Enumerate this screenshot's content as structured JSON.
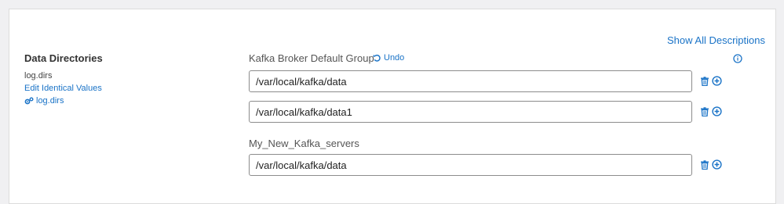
{
  "header": {
    "show_all_label": "Show All Descriptions"
  },
  "property": {
    "title": "Data Directories",
    "name": "log.dirs",
    "edit_identical_label": "Edit Identical Values",
    "log_link_label": "log.dirs"
  },
  "groups": [
    {
      "label": "Kafka Broker Default Group",
      "undo_label": "Undo",
      "values": [
        "/var/local/kafka/data",
        "/var/local/kafka/data1"
      ]
    },
    {
      "label": "My_New_Kafka_servers",
      "values": [
        "/var/local/kafka/data"
      ]
    }
  ],
  "colors": {
    "accent": "#1a73c7",
    "border": "#8c8c8c"
  },
  "icons": [
    "undo-icon",
    "info-icon",
    "gear-icon",
    "trash-icon",
    "plus-circle-icon"
  ]
}
